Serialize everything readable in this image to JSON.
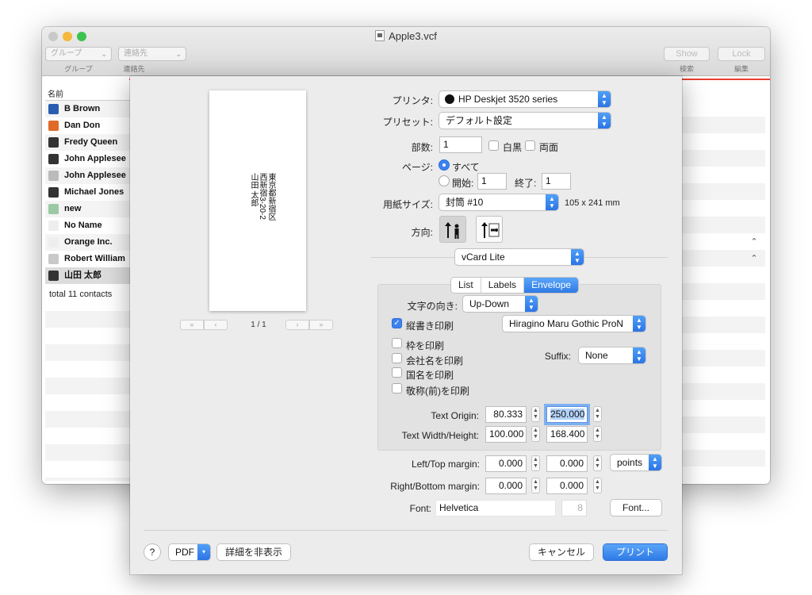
{
  "window": {
    "title": "Apple3.vcf",
    "toolbar": {
      "group_select": "グループ",
      "group_caption": "グループ",
      "contacts_select": "連絡先",
      "contacts_caption": "連絡先",
      "show_button": "Show",
      "show_caption": "検索",
      "lock_button": "Lock",
      "lock_caption": "編集"
    },
    "list": {
      "column_header": "名前",
      "contacts": [
        "B Brown",
        "Dan Don",
        "Fredy Queen",
        "John Applesee",
        "John Applesee",
        "Michael Jones",
        "new",
        "No Name",
        "Orange Inc.",
        "Robert William",
        "山田 太郎"
      ],
      "selected_index": 10,
      "total": "total 11 contacts"
    }
  },
  "preview": {
    "address_lines": [
      "東京都新宿区",
      "西新宿3-20-2",
      "山田 太郎"
    ],
    "pager_first": "«",
    "pager_prev": "‹",
    "pager_next": "›",
    "pager_last": "»",
    "page_label": "1 / 1"
  },
  "print": {
    "printer_label": "プリンタ:",
    "printer_value": "HP Deskjet 3520 series",
    "preset_label": "プリセット:",
    "preset_value": "デフォルト設定",
    "copies_label": "部数:",
    "copies_value": "1",
    "bw_label": "白黒",
    "duplex_label": "両面",
    "pages_label": "ページ:",
    "pages_all": "すべて",
    "pages_from_label": "開始:",
    "pages_from": "1",
    "pages_to_label": "終了:",
    "pages_to": "1",
    "paper_label": "用紙サイズ:",
    "paper_value": "封筒 #10",
    "paper_dims": "105 x 241 mm",
    "orientation_label": "方向:",
    "app_select": "vCard Lite"
  },
  "vcard": {
    "tabs": [
      "List",
      "Labels",
      "Envelope"
    ],
    "active_tab": "Envelope",
    "text_direction_label": "文字の向き:",
    "text_direction_value": "Up-Down",
    "vertical_print_label": "縦書き印刷",
    "vertical_print_checked": true,
    "font_family_value": "Hiragino Maru Gothic ProN",
    "frame_label": "枠を印刷",
    "company_label": "会社名を印刷",
    "country_label": "国名を印刷",
    "honorific_label": "敬称(前)を印刷",
    "suffix_label": "Suffix:",
    "suffix_value": "None",
    "text_origin_label": "Text Origin:",
    "text_origin_x": "80.333",
    "text_origin_y": "250.000",
    "text_size_label": "Text Width/Height:",
    "text_width": "100.000",
    "text_height": "168.400",
    "left_top_label": "Left/Top margin:",
    "left_margin": "0.000",
    "top_margin": "0.000",
    "units_value": "points",
    "right_bottom_label": "Right/Bottom margin:",
    "right_margin": "0.000",
    "bottom_margin": "0.000",
    "font_label": "Font:",
    "font_value": "Helvetica",
    "font_size": "8",
    "font_button": "Font..."
  },
  "footer": {
    "help": "?",
    "pdf": "PDF",
    "hide_details": "詳細を非表示",
    "cancel": "キャンセル",
    "print": "プリント"
  },
  "colors": {
    "accent": "#2f7ae6",
    "red_rule": "#e7402f",
    "traffic_yellow": "#f5b83a",
    "traffic_green": "#3dc24e"
  }
}
